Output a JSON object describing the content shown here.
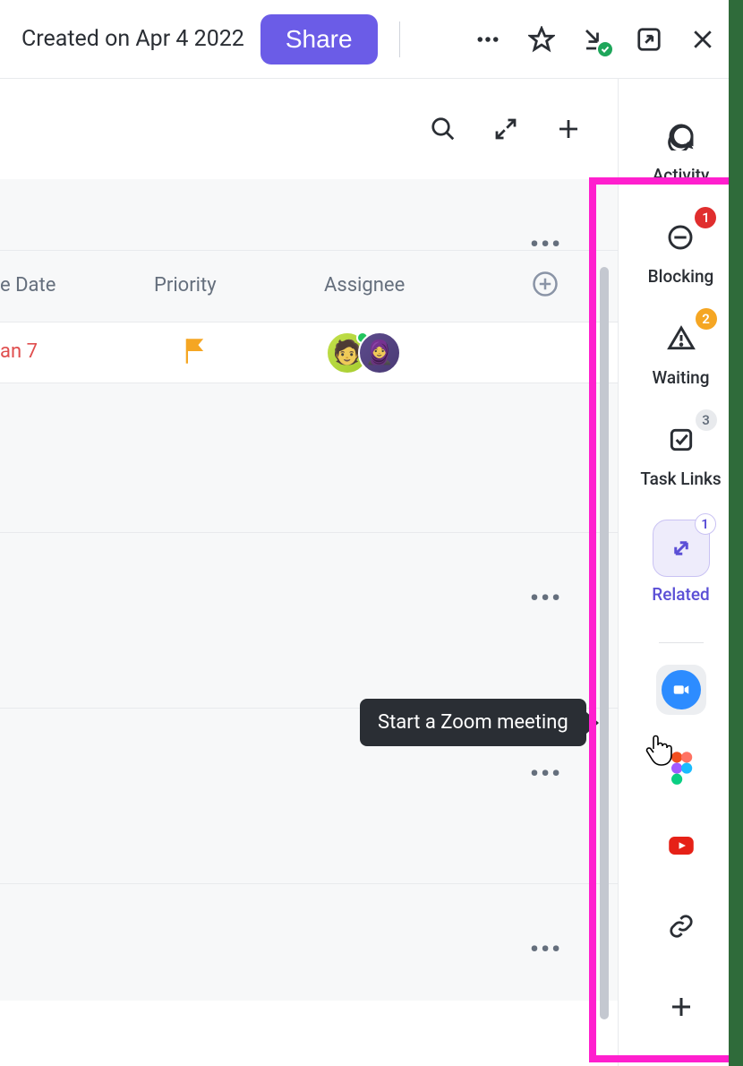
{
  "topbar": {
    "created_text": "Created on Apr 4 2022",
    "share_label": "Share"
  },
  "columns": {
    "date": "e Date",
    "priority": "Priority",
    "assignee": "Assignee"
  },
  "task": {
    "due_date": "an 7"
  },
  "side_rail": {
    "activity": "Activity",
    "blocking": "Blocking",
    "blocking_count": "1",
    "waiting": "Waiting",
    "waiting_count": "2",
    "task_links": "Task Links",
    "task_links_count": "3",
    "related": "Related",
    "related_count": "1"
  },
  "tooltip": {
    "zoom": "Start a Zoom meeting"
  }
}
